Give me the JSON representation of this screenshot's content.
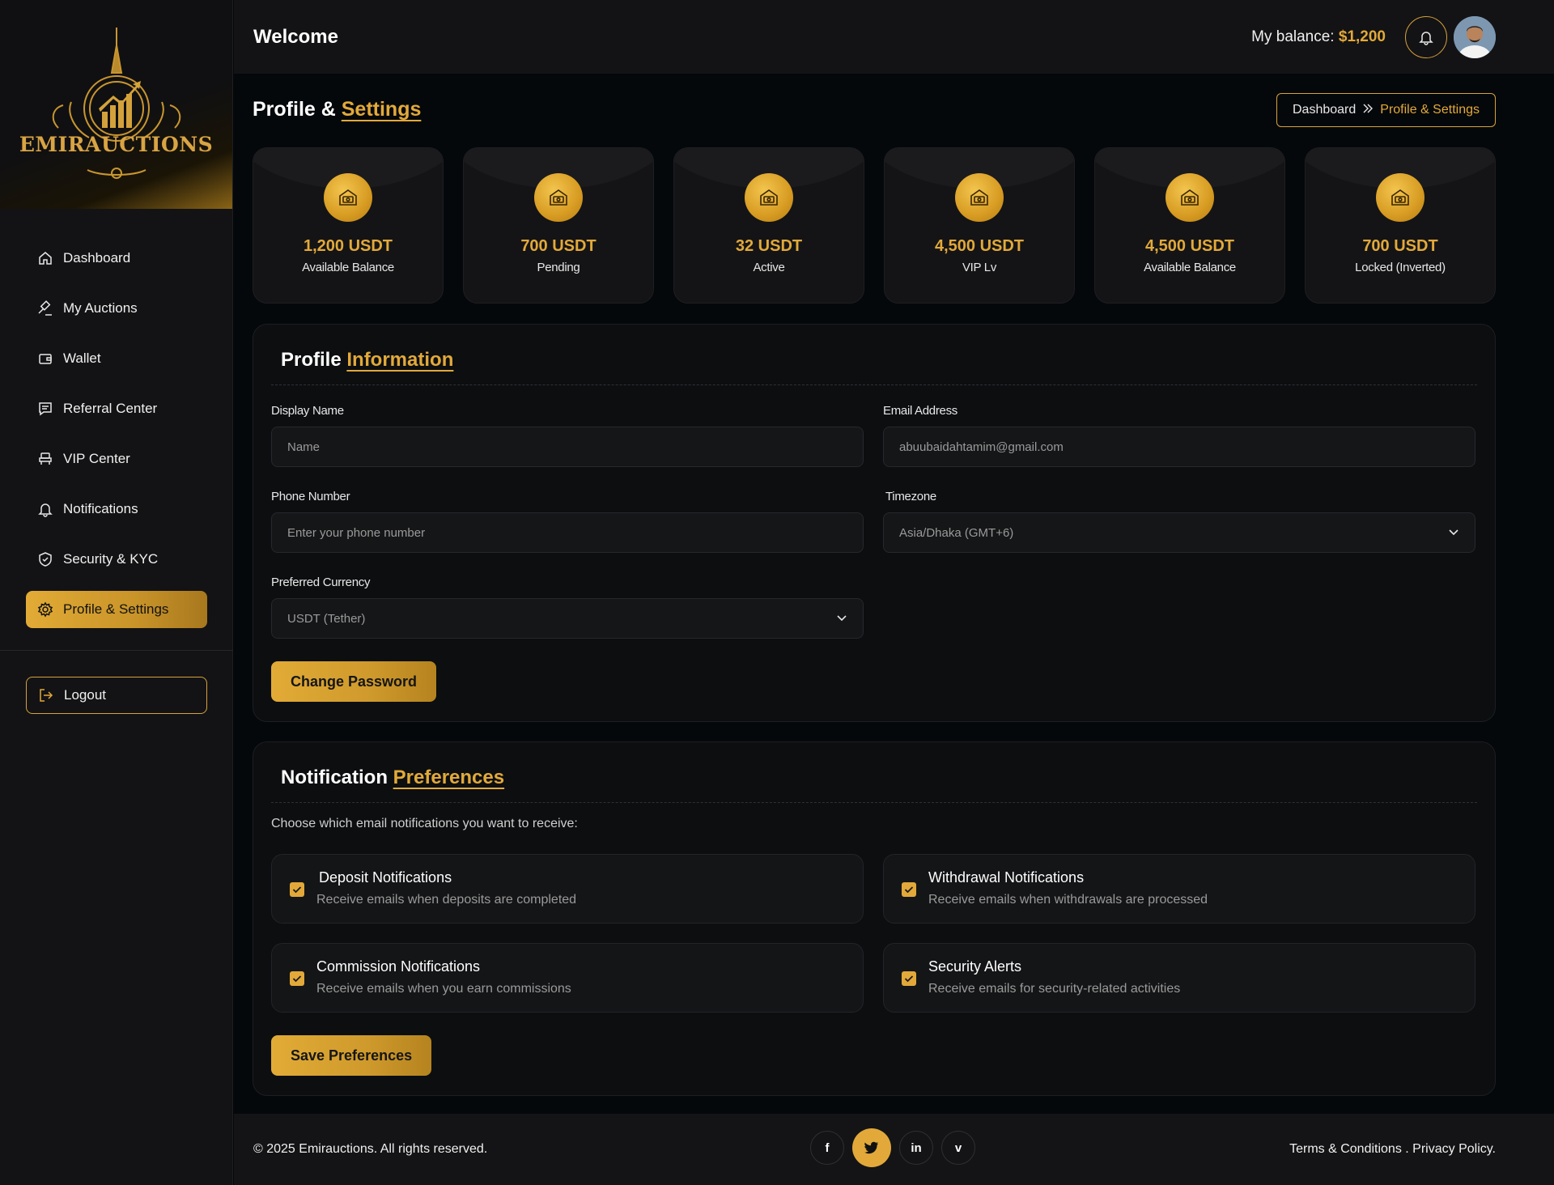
{
  "brand": {
    "name": "EMIRAUCTIONS"
  },
  "sidebar": {
    "items": [
      {
        "label": "Dashboard",
        "icon": "home-icon"
      },
      {
        "label": "My Auctions",
        "icon": "gavel-icon"
      },
      {
        "label": "Wallet",
        "icon": "wallet-icon"
      },
      {
        "label": "Referral Center",
        "icon": "message-icon"
      },
      {
        "label": "VIP Center",
        "icon": "vip-icon"
      },
      {
        "label": "Notifications",
        "icon": "bell-icon"
      },
      {
        "label": "Security & KYC",
        "icon": "shield-icon"
      },
      {
        "label": "Profile & Settings",
        "icon": "gear-icon",
        "active": true
      }
    ],
    "logout": "Logout"
  },
  "header": {
    "title": "Welcome",
    "balance_label": "My balance:",
    "balance_value": "$1,200"
  },
  "page": {
    "title_main": "Profile &",
    "title_accent": "Settings",
    "breadcrumb": {
      "home": "Dashboard",
      "current": "Profile & Settings"
    }
  },
  "stats": [
    {
      "value": "1,200 USDT",
      "label": "Available Balance"
    },
    {
      "value": "700 USDT",
      "label": "Pending"
    },
    {
      "value": "32 USDT",
      "label": "Active"
    },
    {
      "value": "4,500 USDT",
      "label": "VIP Lv"
    },
    {
      "value": "4,500 USDT",
      "label": "Available Balance"
    },
    {
      "value": "700 USDT",
      "label": "Locked (Inverted)"
    }
  ],
  "profile": {
    "title_main": "Profile",
    "title_accent": "Information",
    "display_name": {
      "label": "Display Name",
      "placeholder": "Name",
      "value": ""
    },
    "email": {
      "label": "Email Address",
      "value": "abuubaidahtamim@gmail.com"
    },
    "phone": {
      "label": "Phone Number",
      "placeholder": "Enter your phone number",
      "value": ""
    },
    "timezone": {
      "label": "Timezone",
      "value": "Asia/Dhaka (GMT+6)"
    },
    "currency": {
      "label": "Preferred Currency",
      "value": "USDT (Tether)"
    },
    "change_password": "Change Password"
  },
  "notifications": {
    "title_main": "Notification",
    "title_accent": "Preferences",
    "subtitle": "Choose which email notifications you want to receive:",
    "items": [
      {
        "title": "Deposit Notifications",
        "desc": "Receive emails when deposits are completed",
        "checked": true
      },
      {
        "title": "Withdrawal Notifications",
        "desc": "Receive emails when withdrawals are processed",
        "checked": true
      },
      {
        "title": "Commission Notifications",
        "desc": "Receive emails when you earn commissions",
        "checked": true
      },
      {
        "title": "Security Alerts",
        "desc": "Receive emails for security-related activities",
        "checked": true
      }
    ],
    "save": "Save Preferences"
  },
  "footer": {
    "copyright": "© 2025 Emirauctions. All rights reserved.",
    "socials": [
      {
        "icon": "facebook-icon",
        "glyph": "f"
      },
      {
        "icon": "twitter-icon",
        "glyph": "t"
      },
      {
        "icon": "linkedin-icon",
        "glyph": "in"
      },
      {
        "icon": "vimeo-icon",
        "glyph": "v"
      }
    ],
    "legal": "Terms & Conditions . Privacy Policy."
  },
  "colors": {
    "accent": "#e2a93a",
    "background": "#05080b",
    "panel": "#131315"
  }
}
